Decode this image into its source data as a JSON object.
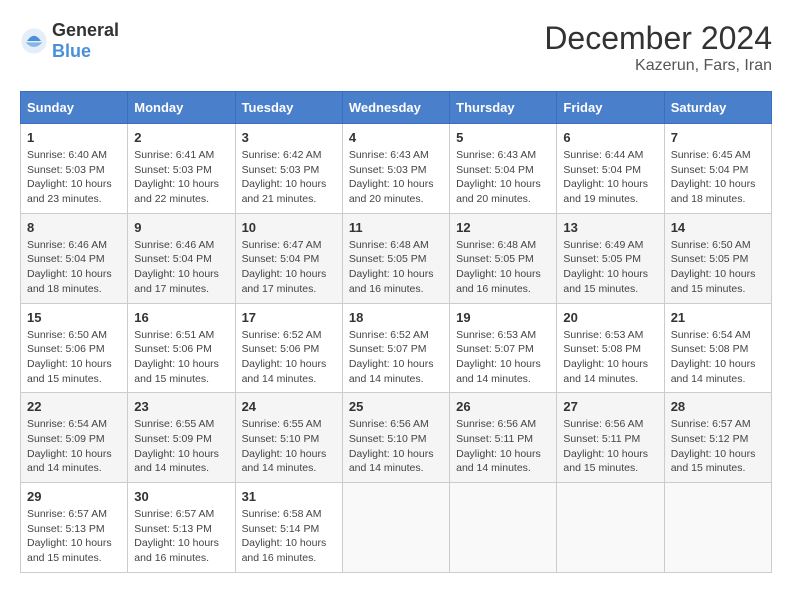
{
  "logo": {
    "general": "General",
    "blue": "Blue"
  },
  "title": {
    "month": "December 2024",
    "location": "Kazerun, Fars, Iran"
  },
  "weekdays": [
    "Sunday",
    "Monday",
    "Tuesday",
    "Wednesday",
    "Thursday",
    "Friday",
    "Saturday"
  ],
  "weeks": [
    [
      {
        "day": "1",
        "sunrise": "6:40 AM",
        "sunset": "5:03 PM",
        "daylight": "10 hours and 23 minutes."
      },
      {
        "day": "2",
        "sunrise": "6:41 AM",
        "sunset": "5:03 PM",
        "daylight": "10 hours and 22 minutes."
      },
      {
        "day": "3",
        "sunrise": "6:42 AM",
        "sunset": "5:03 PM",
        "daylight": "10 hours and 21 minutes."
      },
      {
        "day": "4",
        "sunrise": "6:43 AM",
        "sunset": "5:03 PM",
        "daylight": "10 hours and 20 minutes."
      },
      {
        "day": "5",
        "sunrise": "6:43 AM",
        "sunset": "5:04 PM",
        "daylight": "10 hours and 20 minutes."
      },
      {
        "day": "6",
        "sunrise": "6:44 AM",
        "sunset": "5:04 PM",
        "daylight": "10 hours and 19 minutes."
      },
      {
        "day": "7",
        "sunrise": "6:45 AM",
        "sunset": "5:04 PM",
        "daylight": "10 hours and 18 minutes."
      }
    ],
    [
      {
        "day": "8",
        "sunrise": "6:46 AM",
        "sunset": "5:04 PM",
        "daylight": "10 hours and 18 minutes."
      },
      {
        "day": "9",
        "sunrise": "6:46 AM",
        "sunset": "5:04 PM",
        "daylight": "10 hours and 17 minutes."
      },
      {
        "day": "10",
        "sunrise": "6:47 AM",
        "sunset": "5:04 PM",
        "daylight": "10 hours and 17 minutes."
      },
      {
        "day": "11",
        "sunrise": "6:48 AM",
        "sunset": "5:05 PM",
        "daylight": "10 hours and 16 minutes."
      },
      {
        "day": "12",
        "sunrise": "6:48 AM",
        "sunset": "5:05 PM",
        "daylight": "10 hours and 16 minutes."
      },
      {
        "day": "13",
        "sunrise": "6:49 AM",
        "sunset": "5:05 PM",
        "daylight": "10 hours and 15 minutes."
      },
      {
        "day": "14",
        "sunrise": "6:50 AM",
        "sunset": "5:05 PM",
        "daylight": "10 hours and 15 minutes."
      }
    ],
    [
      {
        "day": "15",
        "sunrise": "6:50 AM",
        "sunset": "5:06 PM",
        "daylight": "10 hours and 15 minutes."
      },
      {
        "day": "16",
        "sunrise": "6:51 AM",
        "sunset": "5:06 PM",
        "daylight": "10 hours and 15 minutes."
      },
      {
        "day": "17",
        "sunrise": "6:52 AM",
        "sunset": "5:06 PM",
        "daylight": "10 hours and 14 minutes."
      },
      {
        "day": "18",
        "sunrise": "6:52 AM",
        "sunset": "5:07 PM",
        "daylight": "10 hours and 14 minutes."
      },
      {
        "day": "19",
        "sunrise": "6:53 AM",
        "sunset": "5:07 PM",
        "daylight": "10 hours and 14 minutes."
      },
      {
        "day": "20",
        "sunrise": "6:53 AM",
        "sunset": "5:08 PM",
        "daylight": "10 hours and 14 minutes."
      },
      {
        "day": "21",
        "sunrise": "6:54 AM",
        "sunset": "5:08 PM",
        "daylight": "10 hours and 14 minutes."
      }
    ],
    [
      {
        "day": "22",
        "sunrise": "6:54 AM",
        "sunset": "5:09 PM",
        "daylight": "10 hours and 14 minutes."
      },
      {
        "day": "23",
        "sunrise": "6:55 AM",
        "sunset": "5:09 PM",
        "daylight": "10 hours and 14 minutes."
      },
      {
        "day": "24",
        "sunrise": "6:55 AM",
        "sunset": "5:10 PM",
        "daylight": "10 hours and 14 minutes."
      },
      {
        "day": "25",
        "sunrise": "6:56 AM",
        "sunset": "5:10 PM",
        "daylight": "10 hours and 14 minutes."
      },
      {
        "day": "26",
        "sunrise": "6:56 AM",
        "sunset": "5:11 PM",
        "daylight": "10 hours and 14 minutes."
      },
      {
        "day": "27",
        "sunrise": "6:56 AM",
        "sunset": "5:11 PM",
        "daylight": "10 hours and 15 minutes."
      },
      {
        "day": "28",
        "sunrise": "6:57 AM",
        "sunset": "5:12 PM",
        "daylight": "10 hours and 15 minutes."
      }
    ],
    [
      {
        "day": "29",
        "sunrise": "6:57 AM",
        "sunset": "5:13 PM",
        "daylight": "10 hours and 15 minutes."
      },
      {
        "day": "30",
        "sunrise": "6:57 AM",
        "sunset": "5:13 PM",
        "daylight": "10 hours and 16 minutes."
      },
      {
        "day": "31",
        "sunrise": "6:58 AM",
        "sunset": "5:14 PM",
        "daylight": "10 hours and 16 minutes."
      },
      null,
      null,
      null,
      null
    ]
  ]
}
